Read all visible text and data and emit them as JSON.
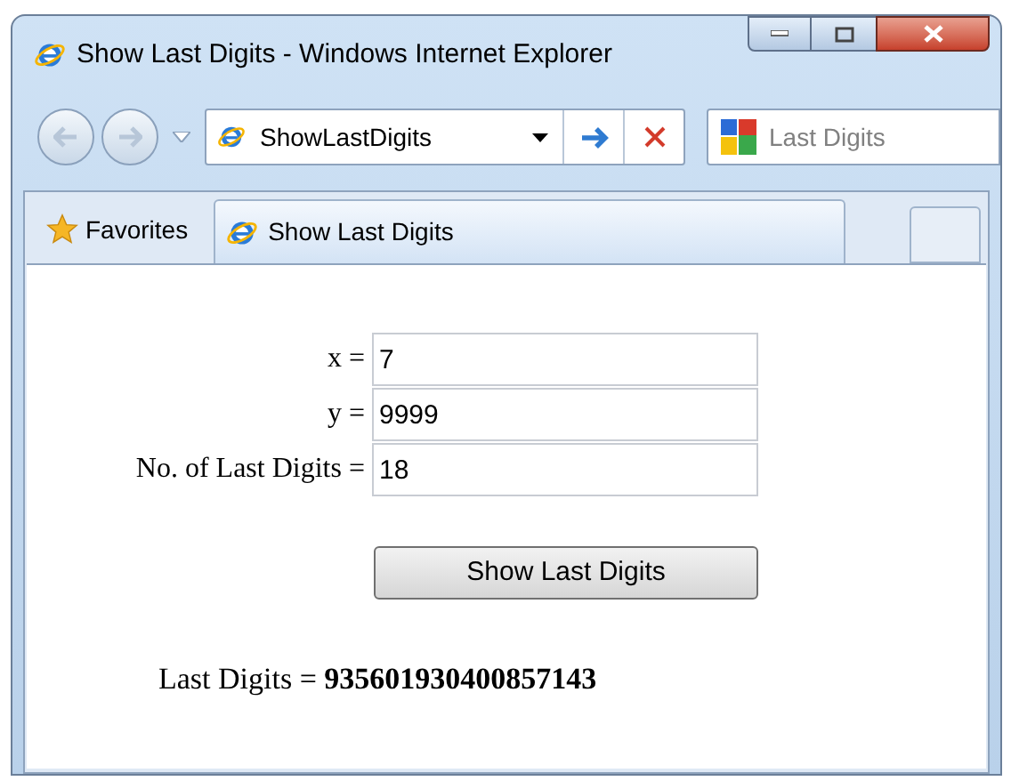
{
  "window": {
    "title": "Show Last Digits - Windows Internet Explorer"
  },
  "address_bar": {
    "value": "ShowLastDigits"
  },
  "search": {
    "value": "Last Digits"
  },
  "favorites": {
    "label": "Favorites"
  },
  "tabs": [
    {
      "label": "Show Last Digits",
      "selected": true
    }
  ],
  "form": {
    "fields": [
      {
        "label": "x =",
        "value": "7"
      },
      {
        "label": "y =",
        "value": "9999"
      },
      {
        "label": "No. of Last Digits =",
        "value": "18"
      }
    ],
    "button": "Show Last Digits",
    "result": "Last Digits = **935601930400857143**"
  }
}
